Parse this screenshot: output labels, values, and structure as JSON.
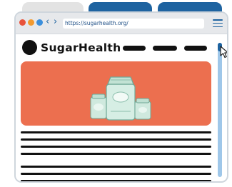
{
  "browser": {
    "url": "https://sugarhealth.org/",
    "nav_back_glyph": "‹",
    "nav_forward_glyph": "›",
    "window_dots": {
      "close": "#e8533b",
      "minimize": "#f29a30",
      "maximize": "#3b8fdc"
    }
  },
  "site": {
    "brand": "SugarHealth"
  },
  "colors": {
    "accent_blue": "#1e63a0",
    "hero_bg": "#ec6f4f",
    "scrollbar_track": "#9fc7e9"
  },
  "icons": {
    "menu": "hamburger-menu-icon",
    "logo": "logo-circle-icon",
    "hero": "sugar-packages-icon",
    "pointer": "mouse-pointer-icon"
  }
}
